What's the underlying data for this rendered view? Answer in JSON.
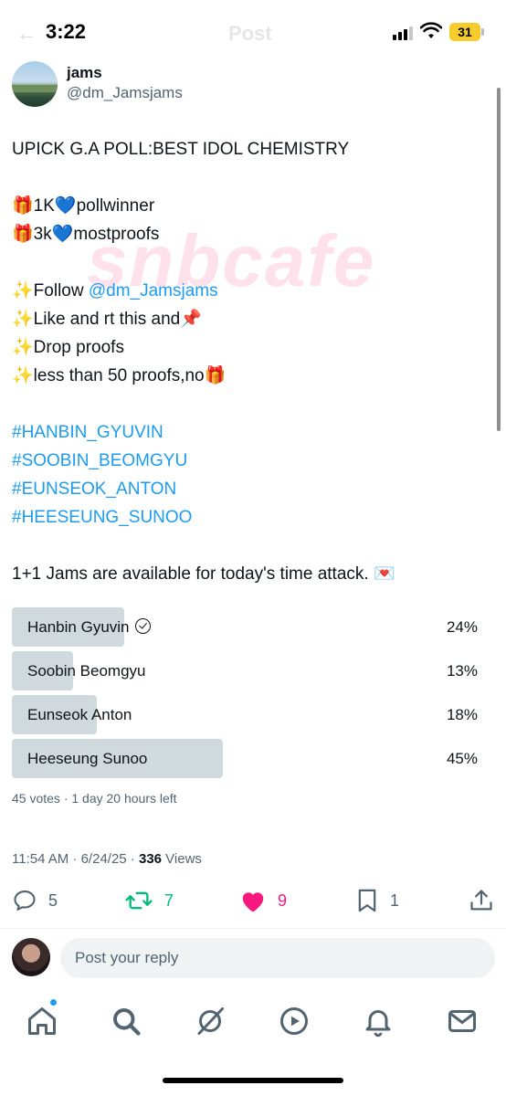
{
  "status_bar": {
    "time": "3:22",
    "battery": "31",
    "ghost_back": "←",
    "ghost_title": "Post"
  },
  "author": {
    "display_name": "jams",
    "handle": "@dm_Jamsjams"
  },
  "watermark": "snbcafe",
  "post": {
    "title_line": "UPICK G.A POLL:BEST IDOL CHEMISTRY",
    "prize_1": {
      "emoji": "🎁",
      "amount": "1K",
      "heart": "💙",
      "text": "pollwinner"
    },
    "prize_2": {
      "emoji": "🎁",
      "amount": "3k",
      "heart": "💙",
      "text": "mostproofs"
    },
    "rules": [
      {
        "emoji": "✨",
        "text": "Follow ",
        "link": "@dm_Jamsjams"
      },
      {
        "emoji": "✨",
        "text": "Like and rt this and",
        "tail": "📌"
      },
      {
        "emoji": "✨",
        "text": "Drop proofs"
      },
      {
        "emoji": "✨",
        "text": "less than 50 proofs,no",
        "tail": "🎁"
      }
    ],
    "hashtags": [
      "#HANBIN_GYUVIN",
      "#SOOBIN_BEOMGYU",
      "#EUNSEOK_ANTON",
      "#HEESEUNG_SUNOO"
    ],
    "closing": "1+1 Jams are available for today's time attack.",
    "closing_emoji": "💌"
  },
  "poll": {
    "options": [
      {
        "label": "Hanbin Gyuvin",
        "percent": "24%",
        "share": 0.24,
        "selected": true
      },
      {
        "label": "Soobin Beomgyu",
        "percent": "13%",
        "share": 0.13,
        "selected": false
      },
      {
        "label": "Eunseok Anton",
        "percent": "18%",
        "share": 0.18,
        "selected": false
      },
      {
        "label": "Heeseung Sunoo",
        "percent": "45%",
        "share": 0.45,
        "selected": false
      }
    ],
    "meta": "45 votes · 1 day 20 hours left"
  },
  "timestamp": {
    "time": "11:54 AM · 6/24/25 · ",
    "views_count": "336",
    "views_label": " Views"
  },
  "actions": {
    "replies": "5",
    "reposts": "7",
    "likes": "9",
    "bookmarks": "1"
  },
  "reply_bar": {
    "placeholder": "Post your reply"
  },
  "colors": {
    "link": "#1d9bf0",
    "repost": "#00ba7c",
    "like": "#f91880",
    "poll_fill": "#cfd9de"
  },
  "icons": [
    "reply-icon",
    "repost-icon",
    "like-icon",
    "bookmark-icon",
    "share-icon",
    "home-icon",
    "search-icon",
    "grok-icon",
    "video-icon",
    "notifications-icon",
    "messages-icon"
  ]
}
